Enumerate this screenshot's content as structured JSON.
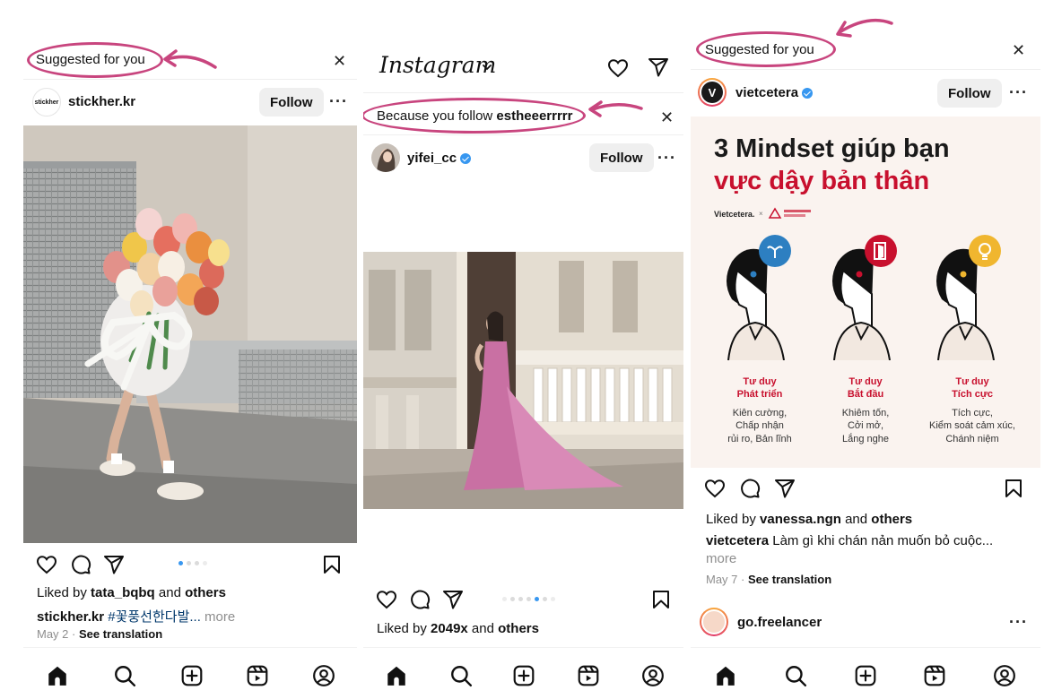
{
  "left_panel": {
    "suggested_label": "Suggested for you",
    "account": "stickher.kr",
    "avatar_text": "stickher",
    "follow_label": "Follow",
    "liked_by_prefix": "Liked by ",
    "liked_by_user": "tata_bqbq",
    "liked_by_and": " and ",
    "liked_by_others": "others",
    "caption_user": "stickher.kr",
    "caption_text": " #꽃풍선한다발...",
    "caption_more": " more",
    "date": "May 2",
    "separator": " · ",
    "see_translation": "See translation"
  },
  "middle_panel": {
    "app_logo": "Instagram",
    "because_prefix": "Because you follow ",
    "because_user": "estheeerrrrr",
    "account": "yifei_cc",
    "follow_label": "Follow",
    "liked_by_prefix": "Liked by ",
    "liked_by_count": "2049x",
    "liked_by_and": " and ",
    "liked_by_others": "others"
  },
  "right_panel": {
    "suggested_label": "Suggested for you",
    "account": "vietcetera",
    "avatar_letter": "V",
    "follow_label": "Follow",
    "infographic": {
      "title": "3 Mindset giúp bạn",
      "subtitle": "vực dậy bản thân",
      "brand": "Vietcetera.",
      "columns": [
        {
          "title_1": "Tư duy",
          "title_2": "Phát triển",
          "desc": [
            "Kiên cường,",
            "Chấp nhận",
            "rủi ro, Bản lĩnh"
          ]
        },
        {
          "title_1": "Tư duy",
          "title_2": "Bắt đầu",
          "desc": [
            "Khiêm tốn,",
            "Cởi mở,",
            "Lắng nghe"
          ]
        },
        {
          "title_1": "Tư duy",
          "title_2": "Tích cực",
          "desc": [
            "Tích cực,",
            "Kiểm soát cảm xúc,",
            "Chánh niệm"
          ]
        }
      ]
    },
    "liked_by_prefix": "Liked by ",
    "liked_by_user": "vanessa.ngn",
    "liked_by_and": " and ",
    "liked_by_others": "others",
    "caption_user": "vietcetera",
    "caption_text": " Làm gì khi chán nản muốn bỏ cuộc...",
    "caption_more": "more",
    "date": "May 7",
    "separator": " · ",
    "see_translation": "See translation",
    "next_account": "go.freelancer"
  },
  "colors": {
    "highlight": "#c8457e",
    "verified": "#3797f0",
    "carousel_active": "#3897f0",
    "infographic_red": "#c8102e"
  },
  "icons": [
    "close-icon",
    "heart-icon",
    "comment-icon",
    "share-icon",
    "bookmark-icon",
    "home-icon",
    "search-icon",
    "create-icon",
    "reels-icon",
    "profile-icon",
    "chevron-down-icon",
    "messenger-icon",
    "verified-icon",
    "more-icon"
  ]
}
